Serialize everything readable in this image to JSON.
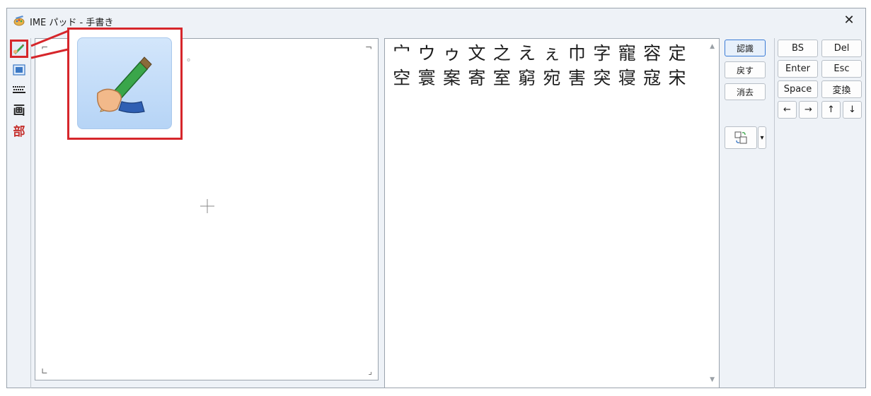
{
  "window": {
    "title": "IME パッド - 手書き",
    "close": "✕"
  },
  "sidebar": {
    "items": [
      {
        "name": "handwriting",
        "icon": "handwriting-pen-icon",
        "selected": true
      },
      {
        "name": "character-list",
        "icon": "character-list-icon"
      },
      {
        "name": "soft-keyboard",
        "icon": "keyboard-icon"
      },
      {
        "name": "stroke-count",
        "glyph": "画"
      },
      {
        "name": "radical",
        "glyph": "部"
      }
    ]
  },
  "writing_area": {
    "ghost_text": "。",
    "corner_tl": "⌐",
    "corner_tr": "¬",
    "corner_bl": "∟",
    "corner_br": "⌟",
    "crosshair_icon": "crosshair-icon"
  },
  "callout": {
    "icon": "handwriting-pen-icon"
  },
  "candidates": {
    "row1": [
      "宀",
      "ウ",
      "ゥ",
      "文",
      "之",
      "え",
      "ぇ",
      "巾",
      "字",
      "寵",
      "容",
      "定"
    ],
    "row2": [
      "空",
      "寰",
      "案",
      "寄",
      "室",
      "窮",
      "宛",
      "害",
      "突",
      "寝",
      "寇",
      "宋"
    ],
    "scroll_up": "▲",
    "scroll_down": "▼"
  },
  "actions": {
    "recognize": "認識",
    "undo": "戻す",
    "clear": "消去",
    "options_icon": "recognition-options-icon",
    "dropdown": "▾"
  },
  "keys": {
    "bs": "BS",
    "del": "Del",
    "enter": "Enter",
    "esc": "Esc",
    "space": "Space",
    "convert": "変換",
    "left": "←",
    "right": "→",
    "up": "↑",
    "down": "↓"
  },
  "colors": {
    "highlight": "#d6262b",
    "window_bg": "#eef2f7",
    "primary_border": "#3a7bd5"
  }
}
